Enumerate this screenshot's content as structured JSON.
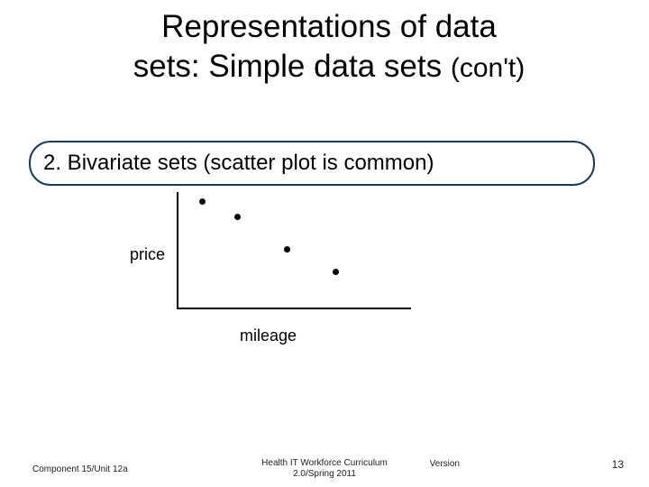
{
  "title": {
    "line1": "Representations of data",
    "line2a": "sets: Simple data sets ",
    "line2b": "(con't)"
  },
  "box_heading": "2. Bivariate sets (scatter plot is common)",
  "chart_data": {
    "type": "scatter",
    "title": "",
    "xlabel": "mileage",
    "ylabel": "price",
    "xlim": [
      0,
      10
    ],
    "ylim": [
      0,
      10
    ],
    "series": [
      {
        "name": "points",
        "points": [
          {
            "x": 1.1,
            "y": 9.2
          },
          {
            "x": 2.6,
            "y": 7.9
          },
          {
            "x": 4.7,
            "y": 5.1
          },
          {
            "x": 6.8,
            "y": 3.2
          }
        ]
      }
    ]
  },
  "footer": {
    "left": "Component 15/Unit 12a",
    "center_line1": "Health IT Workforce Curriculum",
    "center_line2": "2.0/Spring 2011",
    "version_label": "Version",
    "page": "13"
  }
}
